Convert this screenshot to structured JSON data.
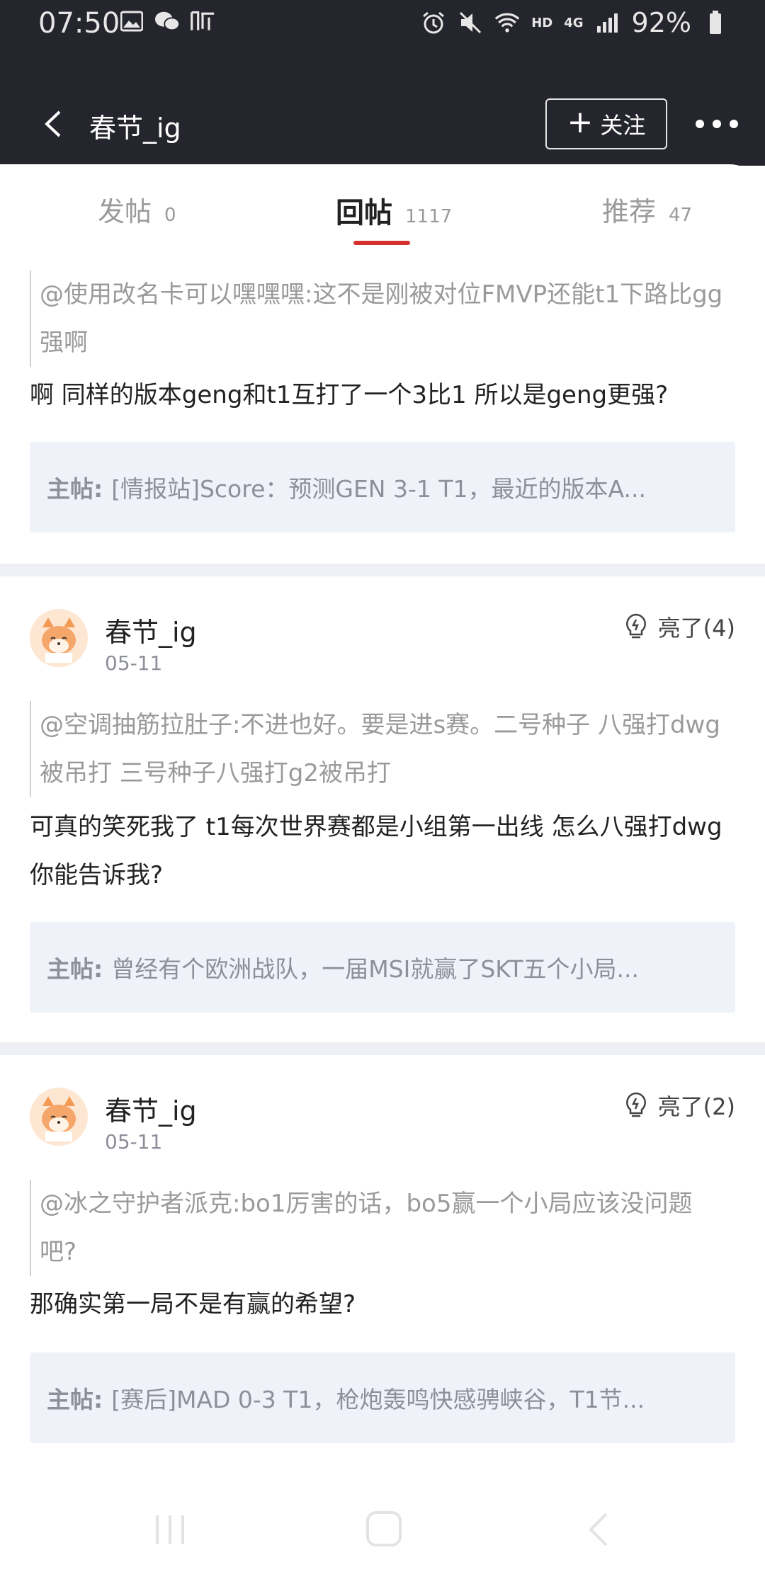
{
  "status": {
    "time": "07:50",
    "hd": "HD",
    "net": "4G",
    "battery": "92%"
  },
  "header": {
    "title": "春节_ig",
    "follow_label": "关注"
  },
  "tabs": [
    {
      "label": "发帖",
      "count": "0"
    },
    {
      "label": "回帖",
      "count": "1117"
    },
    {
      "label": "推荐",
      "count": "47"
    }
  ],
  "main_prefix": "主帖:",
  "posts": [
    {
      "quote": "@使用改名卡可以嘿嘿嘿:这不是刚被对位FMVP还能t1下路比gg强啊",
      "reply": "啊 同样的版本geng和t1互打了一个3比1 所以是geng更强?",
      "main": "[情报站]Score：预测GEN 3-1 T1，最近的版本A..."
    },
    {
      "user": "春节_ig",
      "date": "05-11",
      "like": "亮了(4)",
      "quote": "@空调抽筋拉肚子:不进也好。要是进s赛。二号种子 八强打dwg被吊打 三号种子八强打g2被吊打",
      "reply": "可真的笑死我了 t1每次世界赛都是小组第一出线 怎么八强打dwg你能告诉我?",
      "main": "曾经有个欧洲战队，一届MSI就赢了SKT五个小局..."
    },
    {
      "user": "春节_ig",
      "date": "05-11",
      "like": "亮了(2)",
      "quote": "@冰之守护者派克:bo1厉害的话，bo5赢一个小局应该没问题吧?",
      "reply": "那确实第一局不是有赢的希望?",
      "main": "[赛后]MAD 0-3 T1，枪炮轰鸣快感骋峡谷，T1节..."
    }
  ]
}
